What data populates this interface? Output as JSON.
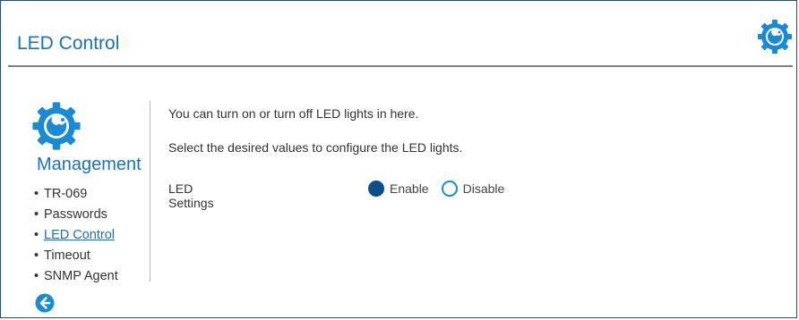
{
  "header": {
    "title": "LED Control",
    "icon": "gear-wrench-icon"
  },
  "sidebar": {
    "icon": "gear-wrench-icon",
    "title": "Management",
    "items": [
      {
        "label": "TR-069",
        "active": false
      },
      {
        "label": "Passwords",
        "active": false
      },
      {
        "label": "LED Control",
        "active": true
      },
      {
        "label": "Timeout",
        "active": false
      },
      {
        "label": "SNMP Agent",
        "active": false
      }
    ],
    "back_icon": "back-arrow-icon"
  },
  "main": {
    "description_1": "You can turn on or turn off LED lights in here.",
    "description_2": "Select the desired values to configure the LED lights.",
    "led_settings": {
      "label": "LED Settings",
      "options": [
        {
          "label": "Enable",
          "selected": true
        },
        {
          "label": "Disable",
          "selected": false
        }
      ]
    }
  },
  "colors": {
    "accent": "#1a73b8",
    "radio_selected": "#0b4f8a",
    "radio_outline": "#1a8ad4"
  }
}
